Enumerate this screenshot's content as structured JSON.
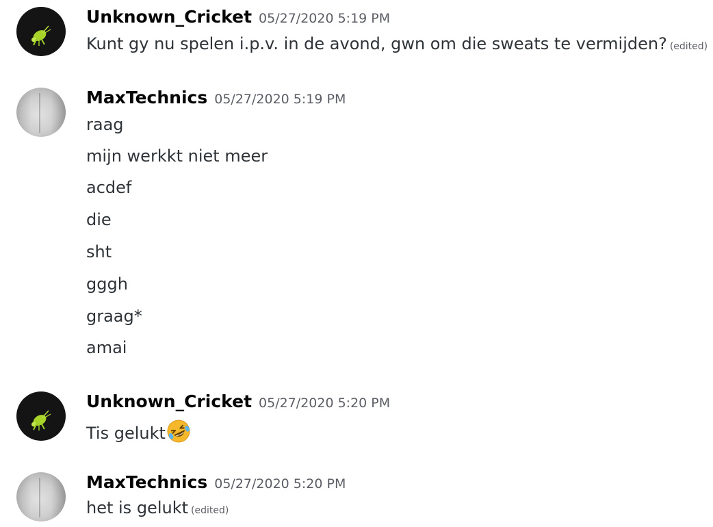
{
  "messages": [
    {
      "author": "Unknown_Cricket",
      "timestamp": "05/27/2020 5:19 PM",
      "lines": [
        {
          "text": "Kunt gy nu spelen i.p.v. in de avond, gwn om die sweats te vermijden?",
          "edited": "(edited)"
        }
      ]
    },
    {
      "author": "MaxTechnics",
      "timestamp": "05/27/2020 5:19 PM",
      "lines": [
        {
          "text": "raag"
        },
        {
          "text": "mijn werkkt niet meer"
        },
        {
          "text": "acdef"
        },
        {
          "text": "die"
        },
        {
          "text": "sht"
        },
        {
          "text": "gggh"
        },
        {
          "text": "graag*"
        },
        {
          "text": "amai"
        }
      ]
    },
    {
      "author": "Unknown_Cricket",
      "timestamp": "05/27/2020 5:20 PM",
      "lines": [
        {
          "text": "Tis gelukt",
          "emoji": "rolling-on-floor-laughing-emoji"
        }
      ]
    },
    {
      "author": "MaxTechnics",
      "timestamp": "05/27/2020 5:20 PM",
      "lines": [
        {
          "text": "het is gelukt",
          "edited": "(edited)"
        }
      ]
    }
  ],
  "colors": {
    "username": "#060607",
    "text": "#2e3338",
    "timestamp": "#5c5e66",
    "background": "#ffffff"
  }
}
